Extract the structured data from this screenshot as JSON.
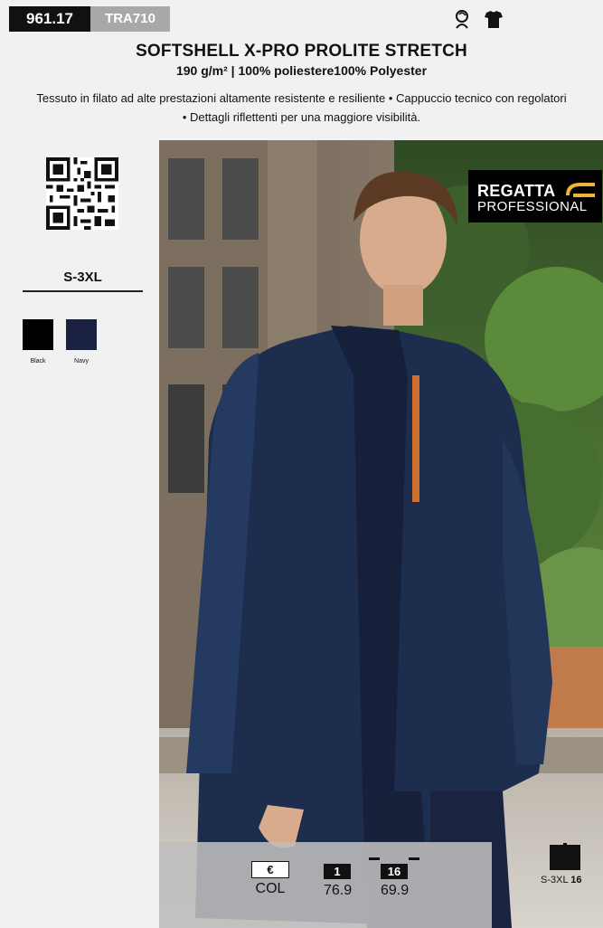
{
  "header": {
    "code": "961.17",
    "alt_code": "TRA710",
    "icons": [
      "female-fit-icon",
      "tshirt-icon"
    ]
  },
  "product": {
    "title": "SOFTSHELL X-PRO PROLITE STRETCH",
    "subtitle": "190 g/m² | 100% poliestere100% Polyester",
    "description_line1": "Tessuto in filato ad alte prestazioni altamente resistente e resiliente • Cappuccio tecnico con regolatori",
    "description_line2": "• Dettagli riflettenti per una maggiore visibilità."
  },
  "sizes": "S-3XL",
  "colors": [
    {
      "name": "Black",
      "hex": "#000000"
    },
    {
      "name": "Navy",
      "hex": "#1b2140"
    }
  ],
  "brand": {
    "line1": "REGATTA",
    "line2": "PROFESSIONAL",
    "accent": "#f2b233"
  },
  "pricing": {
    "currency": "€",
    "col_label": "COL",
    "tier1_qty": "1",
    "tier1_price": "76.9",
    "tier2_qty": "16",
    "tier2_price": "69.9"
  },
  "pack": {
    "sizes": "S-3XL",
    "qty": "16"
  }
}
